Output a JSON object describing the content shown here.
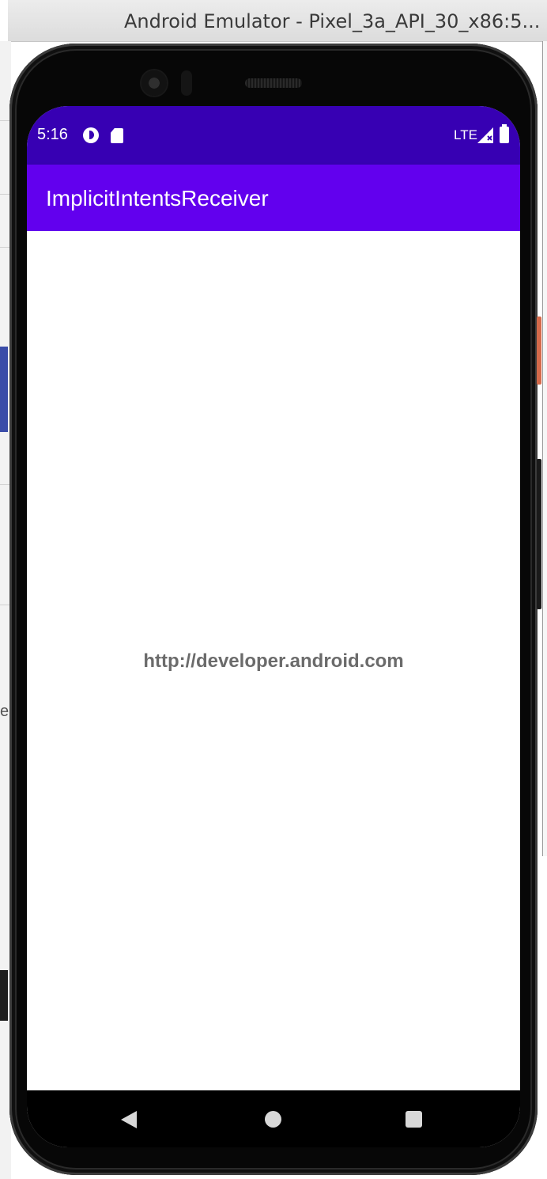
{
  "window": {
    "title": "Android Emulator - Pixel_3a_API_30_x86:5..."
  },
  "background_ide": {
    "partial_char": "e"
  },
  "device": {
    "status_bar": {
      "time": "5:16",
      "network": "LTE",
      "icons": [
        "data-saver-icon",
        "sd-card-icon",
        "signal-icon",
        "battery-icon"
      ]
    },
    "app_bar": {
      "title": "ImplicitIntentsReceiver"
    },
    "content": {
      "uri_text": "http://developer.android.com"
    },
    "nav_bar": {
      "icons": [
        "back-icon",
        "home-icon",
        "recents-icon"
      ]
    }
  },
  "colors": {
    "status_bar": "#3700b3",
    "app_bar": "#6200ee",
    "uri_text": "#6b6b6b",
    "nav_bar": "#000000"
  }
}
